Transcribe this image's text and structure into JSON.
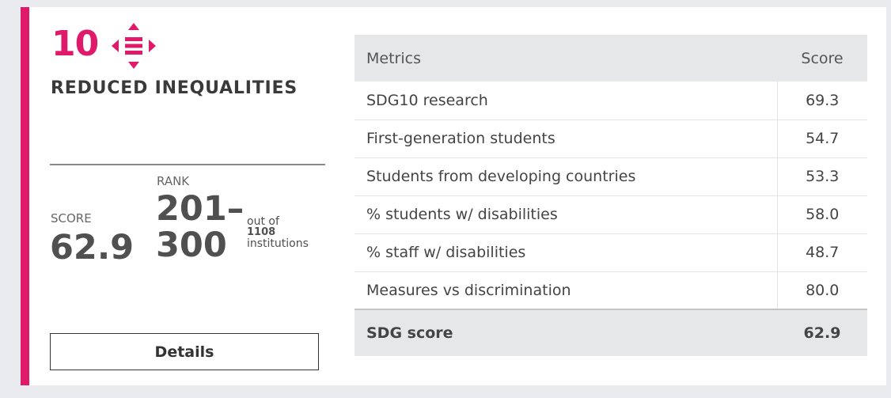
{
  "colors": {
    "accent": "#e01a6b",
    "page_background": "#e9ebee",
    "card_background": "#ffffff"
  },
  "goal": {
    "number": "10",
    "icon": "reduced-inequalities-icon",
    "title": "REDUCED INEQUALITIES"
  },
  "score": {
    "label": "SCORE",
    "value": "62.9"
  },
  "rank": {
    "label": "RANK",
    "value_line1": "201–",
    "value_line2": "300",
    "out_of_text": "out of",
    "total": "1108",
    "institutions_text": "institutions"
  },
  "details_button": {
    "label": "Details"
  },
  "metrics_table": {
    "headers": [
      "Metrics",
      "Score"
    ],
    "rows": [
      {
        "metric": "SDG10 research",
        "score": "69.3"
      },
      {
        "metric": "First-generation students",
        "score": "54.7"
      },
      {
        "metric": "Students from developing countries",
        "score": "53.3"
      },
      {
        "metric": "% students w/ disabilities",
        "score": "58.0"
      },
      {
        "metric": "% staff w/ disabilities",
        "score": "48.7"
      },
      {
        "metric": "Measures vs discrimination",
        "score": "80.0"
      }
    ],
    "total": {
      "label": "SDG score",
      "score": "62.9"
    }
  }
}
